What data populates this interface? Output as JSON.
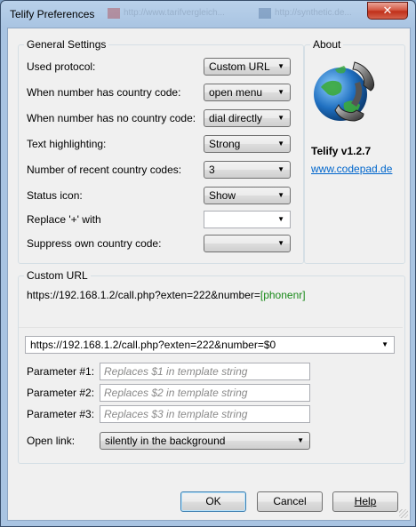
{
  "window": {
    "title": "Telify Preferences",
    "close_label": "✕",
    "background_tabs": [
      "http://www.tarifvergleich...",
      "http://synthetic.de..."
    ]
  },
  "general": {
    "legend": "General Settings",
    "rows": [
      {
        "label": "Used protocol:",
        "value": "Custom URL"
      },
      {
        "label": "When number has country code:",
        "value": "open menu"
      },
      {
        "label": "When number has no country code:",
        "value": "dial directly"
      },
      {
        "label": "Text highlighting:",
        "value": "Strong"
      },
      {
        "label": "Number of recent country codes:",
        "value": "3"
      },
      {
        "label": "Status icon:",
        "value": "Show"
      }
    ],
    "replace_plus": {
      "label": "Replace '+' with",
      "value": ""
    },
    "suppress": {
      "label": "Suppress own country code:",
      "value": ""
    }
  },
  "about": {
    "legend": "About",
    "version": "Telify v1.2.7",
    "website": "www.codepad.de"
  },
  "custom_url": {
    "legend": "Custom URL",
    "display_prefix": "https://192.168.1.2/call.php?exten=222&number=",
    "display_token": "[phonenr]",
    "template_value": "https://192.168.1.2/call.php?exten=222&number=$0",
    "params": [
      {
        "label": "Parameter #1:",
        "placeholder": "Replaces $1 in template string"
      },
      {
        "label": "Parameter #2:",
        "placeholder": "Replaces $2 in template string"
      },
      {
        "label": "Parameter #3:",
        "placeholder": "Replaces $3 in template string"
      }
    ],
    "open_link": {
      "label": "Open link:",
      "value": "silently in the background"
    }
  },
  "buttons": {
    "ok": "OK",
    "cancel": "Cancel",
    "help": "Help"
  },
  "colors": {
    "token_green": "#1a8a1a",
    "link_blue": "#0066cc"
  }
}
